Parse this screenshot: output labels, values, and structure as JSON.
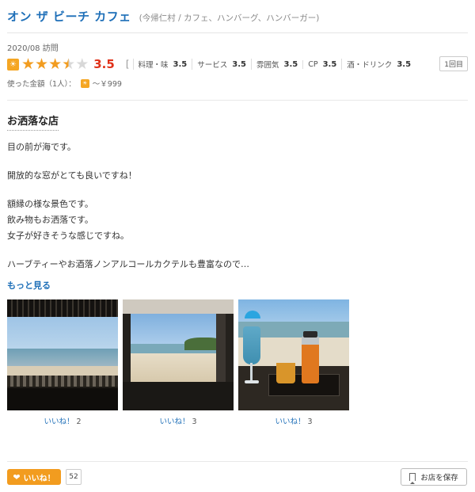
{
  "header": {
    "shop_name": "オン ザ ビーチ カフェ",
    "shop_meta": "(今帰仁村 / カフェ、ハンバーグ、ハンバーガー)"
  },
  "visit": {
    "date": "2020/08 訪問",
    "count_label": "1回目"
  },
  "rating": {
    "score": "3.5",
    "stars_value": 3.5,
    "stars_max": 5,
    "sub_scores": [
      {
        "label": "料理・味",
        "value": "3.5"
      },
      {
        "label": "サービス",
        "value": "3.5"
      },
      {
        "label": "雰囲気",
        "value": "3.5"
      },
      {
        "label": "CP",
        "value": "3.5"
      },
      {
        "label": "酒・ドリンク",
        "value": "3.5"
      }
    ],
    "bracket_open": "["
  },
  "price": {
    "label": "使った金額（1人）：",
    "value": "～￥999"
  },
  "review": {
    "title": "お洒落な店",
    "paragraphs": [
      [
        "目の前が海です。"
      ],
      [
        "開放的な窓がとても良いですね！"
      ],
      [
        "額縁の様な景色です。",
        "飲み物もお洒落です。",
        "女子が好きそうな感じですね。"
      ],
      [
        "ハーブティーやお酒落ノンアルコールカクテルも豊富なので…"
      ]
    ],
    "more_label": "もっと見る"
  },
  "photos": [
    {
      "like_label": "いいね！",
      "like_count": "2"
    },
    {
      "like_label": "いいね！",
      "like_count": "3"
    },
    {
      "like_label": "いいね！",
      "like_count": "3"
    }
  ],
  "footer": {
    "like_button_label": "いいね！",
    "like_total": "52",
    "save_label": "お店を保存"
  },
  "colors": {
    "brand_blue": "#1e6fb8",
    "score_red": "#e0321a",
    "star_orange": "#f29c1f"
  }
}
